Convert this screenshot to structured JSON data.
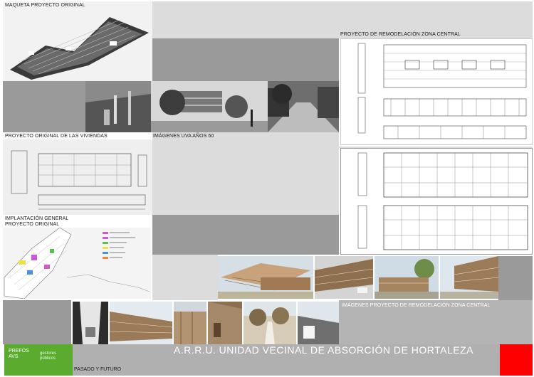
{
  "labels": {
    "maqueta": "MAQUETA PROYECTO ORIGINAL",
    "remodelacion_central": "PROYECTO DE REMODELACIÓN ZONA CENTRAL",
    "proyecto_original_viviendas": "PROYECTO ORIGINAL DE LAS VIVIENDAS",
    "imagenes_uva": "IMÁGENES UVA AÑOS 60",
    "implantacion": "IMPLANTACIÓN GENERAL\nPROYECTO ORIGINAL",
    "imagenes_remodelacion": "IMÁGENES PROYECTO DE REMODELACIÓN ZONA CENTRAL"
  },
  "footer": {
    "title": "A.R.R.U. UNIDAD VECINAL DE ABSORCIÓN DE HORTALEZA",
    "subtitle": "PASADO Y FUTURO",
    "logo_text": "PREFOS\nAVS",
    "logo_sub": "gestores\npúblicos",
    "accent_red": "#ff0000",
    "logo_green": "#5aab2e"
  }
}
